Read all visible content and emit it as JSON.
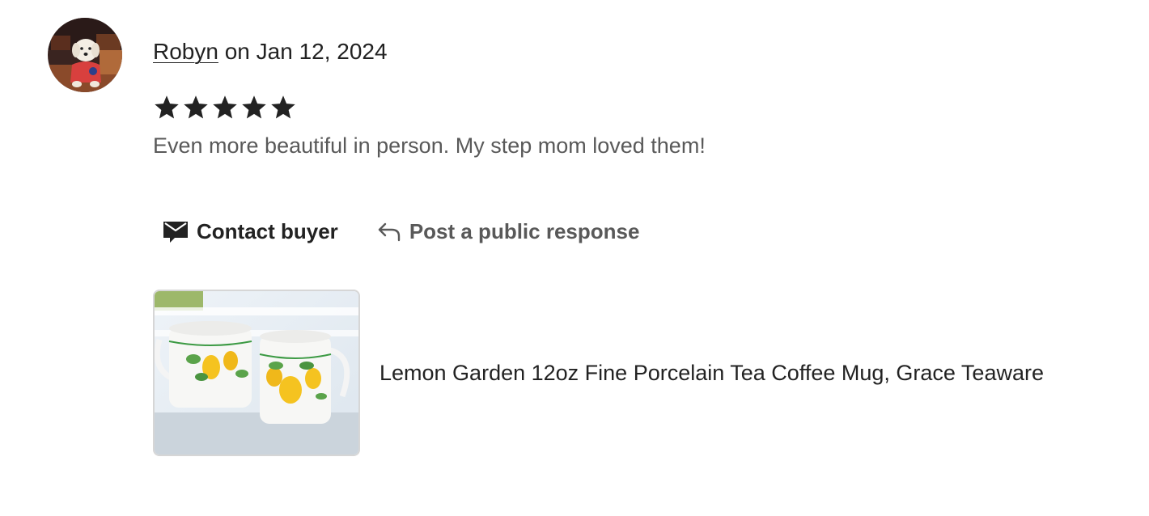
{
  "review": {
    "reviewer_name": "Robyn",
    "date_text": " on Jan 12, 2024",
    "rating": 5,
    "rating_max": 5,
    "text": "Even more beautiful in person. My step mom loved them!"
  },
  "actions": {
    "contact_label": "Contact buyer",
    "respond_label": "Post a public response"
  },
  "listing": {
    "title": "Lemon Garden 12oz Fine Porcelain Tea Coffee Mug, Grace Teaware"
  },
  "icons": {
    "contact": "envelope-icon",
    "respond": "reply-arrow-icon",
    "star": "star-icon"
  },
  "colors": {
    "text_primary": "#222222",
    "text_secondary": "#595959",
    "star": "#222222"
  }
}
